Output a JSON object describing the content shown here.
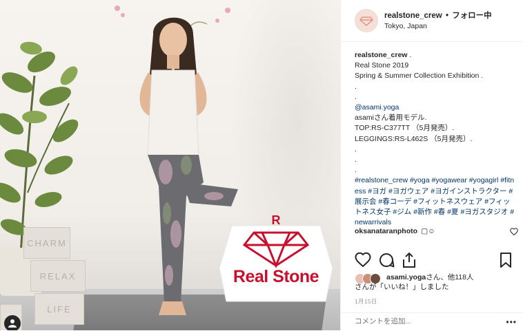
{
  "photo": {
    "sign_text": "Real Stone",
    "blocks": [
      "CHARM",
      "RELAX",
      "LIFE"
    ]
  },
  "header": {
    "username": "realstone_crew",
    "separator": "•",
    "follow_status": "フォロー中",
    "location": "Tokyo, Japan"
  },
  "caption": {
    "username": "realstone_crew",
    "after_username": " .",
    "line1": "Real Stone 2019",
    "line2": "Spring & Summer Collection Exhibition .",
    "dot": ".",
    "mention": "@asami.yoga",
    "line_model": "asamiさん着用モデル.",
    "line_top": "TOP:RS-C377TT （5月発売）.",
    "line_leggings": "LEGGINGS:RS-L462S （5月発売）.",
    "hashtags": "#realstone_crew #yoga #yogawear #yogagirl #fitness #ヨガ #ヨガウェア #ヨガインストラクター #展示会 #春コーデ #フィットネスウェア #フィットネス女子 #ジム #新作 #春 #夏 #ヨガスタジオ #newarrivals"
  },
  "comment": {
    "username": "oksanataranphoto",
    "text": " ▢☺"
  },
  "likes": {
    "username": "asami.yoga",
    "text_part1": "さん、他118人",
    "text_part2": "さんが「いいね！」しました"
  },
  "date": "1月15日",
  "comment_input": {
    "placeholder": "コメントを追加..."
  },
  "more_label": "•••",
  "colors": {
    "brand_red": "#c8102e",
    "link_blue": "#003569",
    "text": "#262626",
    "muted": "#999999"
  }
}
